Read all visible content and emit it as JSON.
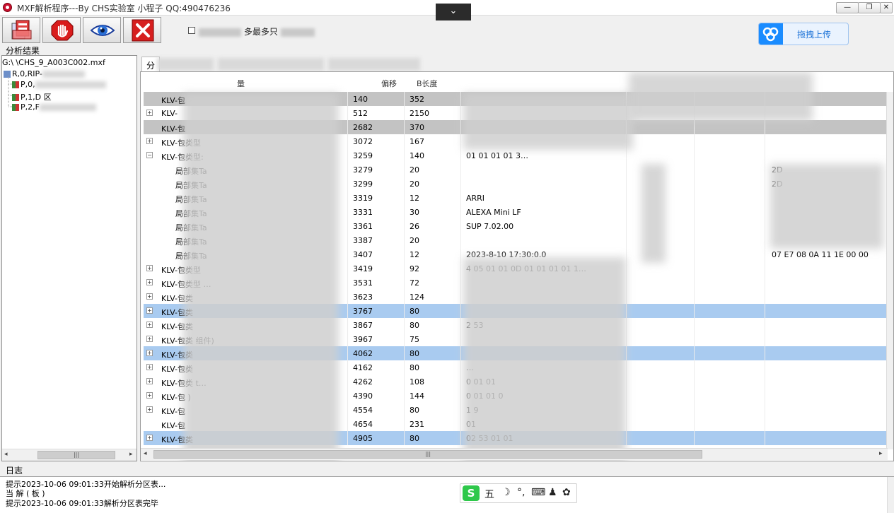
{
  "window": {
    "title": "MXF解析程序---By CHS实验室 小程子 QQ:490476236",
    "collapse_glyph": "⌄",
    "minimize": "—",
    "restore": "❐",
    "close": "✕"
  },
  "toolbar": {
    "buttons": [
      {
        "icon": "open-file-icon"
      },
      {
        "icon": "stop-icon"
      },
      {
        "icon": "eye-icon"
      },
      {
        "icon": "close-icon"
      }
    ],
    "option_label": "多最多只",
    "upload_label": "拖拽上传"
  },
  "left_panel": {
    "title": "分析结果",
    "tree": [
      {
        "label": "G:\\          \\CHS_9_A003C002.mxf"
      },
      {
        "label": "R,0,RIP-"
      },
      {
        "label": "P,0,"
      },
      {
        "label": "P,1,D                 区"
      },
      {
        "label": "P,2,F"
      }
    ]
  },
  "tabs": [
    {
      "label": "分"
    }
  ],
  "table": {
    "headers": [
      "量",
      "偏移",
      "B长度"
    ],
    "rows": [
      {
        "name": "KLV-包",
        "offset": "140",
        "len": "352",
        "value": "",
        "extra": "",
        "expander": "",
        "indent": 0,
        "style": "gray"
      },
      {
        "name": "KLV-",
        "offset": "512",
        "len": "2150",
        "value": "",
        "extra": "",
        "expander": "+",
        "indent": 0,
        "style": ""
      },
      {
        "name": "KLV-包",
        "offset": "2682",
        "len": "370",
        "value": "",
        "extra": "",
        "expander": "",
        "indent": 0,
        "style": "gray"
      },
      {
        "name": "KLV-包类型",
        "offset": "3072",
        "len": "167",
        "value": "",
        "extra": "",
        "expander": "+",
        "indent": 0,
        "style": ""
      },
      {
        "name": "KLV-包类型:",
        "offset": "3259",
        "len": "140",
        "value": "01 01 01 01 3…",
        "extra": "",
        "expander": "−",
        "indent": 0,
        "style": ""
      },
      {
        "name": "局部集Ta",
        "offset": "3279",
        "len": "20",
        "value": "",
        "extra": "2D",
        "expander": "",
        "indent": 1,
        "style": ""
      },
      {
        "name": "局部集Ta",
        "offset": "3299",
        "len": "20",
        "value": "",
        "extra": "2D",
        "expander": "",
        "indent": 1,
        "style": ""
      },
      {
        "name": "局部集Ta",
        "offset": "3319",
        "len": "12",
        "value": "ARRI",
        "extra": "",
        "expander": "",
        "indent": 1,
        "style": ""
      },
      {
        "name": "局部集Ta",
        "offset": "3331",
        "len": "30",
        "value": "ALEXA Mini LF",
        "extra": "",
        "expander": "",
        "indent": 1,
        "style": ""
      },
      {
        "name": "局部集Ta",
        "offset": "3361",
        "len": "26",
        "value": "SUP 7.02.00",
        "extra": "",
        "expander": "",
        "indent": 1,
        "style": ""
      },
      {
        "name": "局部集Ta",
        "offset": "3387",
        "len": "20",
        "value": "",
        "extra": "",
        "expander": "",
        "indent": 1,
        "style": ""
      },
      {
        "name": "局部集Ta",
        "offset": "3407",
        "len": "12",
        "value": "2023-8-10 17:30:0.0",
        "extra": "07 E7 08 0A 11 1E 00 00",
        "expander": "",
        "indent": 1,
        "style": ""
      },
      {
        "name": "KLV-包类型",
        "offset": "3419",
        "len": "92",
        "value": "4 05 01 01 0D 01 01 01 01 1…",
        "extra": "",
        "expander": "+",
        "indent": 0,
        "style": ""
      },
      {
        "name": "KLV-包类型 …",
        "offset": "3531",
        "len": "72",
        "value": "",
        "extra": "",
        "expander": "+",
        "indent": 0,
        "style": ""
      },
      {
        "name": "KLV-包类",
        "offset": "3623",
        "len": "124",
        "value": "",
        "extra": "",
        "expander": "+",
        "indent": 0,
        "style": ""
      },
      {
        "name": "KLV-包类",
        "offset": "3767",
        "len": "80",
        "value": "",
        "extra": "",
        "expander": "+",
        "indent": 0,
        "style": "blue"
      },
      {
        "name": "KLV-包类",
        "offset": "3867",
        "len": "80",
        "value": "2 53",
        "extra": "",
        "expander": "+",
        "indent": 0,
        "style": ""
      },
      {
        "name": "KLV-包类   组件)",
        "offset": "3967",
        "len": "75",
        "value": "",
        "extra": "",
        "expander": "+",
        "indent": 0,
        "style": ""
      },
      {
        "name": "KLV-包类",
        "offset": "4062",
        "len": "80",
        "value": "",
        "extra": "",
        "expander": "+",
        "indent": 0,
        "style": "blue"
      },
      {
        "name": "KLV-包类",
        "offset": "4162",
        "len": "80",
        "value": "…",
        "extra": "",
        "expander": "+",
        "indent": 0,
        "style": ""
      },
      {
        "name": "KLV-包类   t…",
        "offset": "4262",
        "len": "108",
        "value": "0   01 01",
        "extra": "",
        "expander": "+",
        "indent": 0,
        "style": ""
      },
      {
        "name": "KLV-包   )",
        "offset": "4390",
        "len": "144",
        "value": "0   01 01 0",
        "extra": "",
        "expander": "+",
        "indent": 0,
        "style": ""
      },
      {
        "name": "KLV-包",
        "offset": "4554",
        "len": "80",
        "value": "1 9",
        "extra": "",
        "expander": "+",
        "indent": 0,
        "style": ""
      },
      {
        "name": "KLV-包",
        "offset": "4654",
        "len": "231",
        "value": "01",
        "extra": "",
        "expander": "",
        "indent": 0,
        "style": ""
      },
      {
        "name": "KLV-包类",
        "offset": "4905",
        "len": "80",
        "value": "02 53 01 01",
        "extra": "",
        "expander": "+",
        "indent": 0,
        "style": "blue"
      }
    ]
  },
  "log": {
    "title": "日志",
    "lines": [
      "提示2023-10-06 09:01:33开始解析分区表...",
      "当         解     (        板    )",
      "提示2023-10-06 09:01:33解析分区表完毕"
    ]
  },
  "ime": {
    "logo": "S",
    "items": [
      "五",
      "☽",
      "°,",
      "⌨",
      "♟",
      "✿"
    ]
  },
  "colors": {
    "row_gray": "#c3c3c3",
    "row_blue": "#a9cbf0",
    "upload_accent": "#1a8cff"
  }
}
